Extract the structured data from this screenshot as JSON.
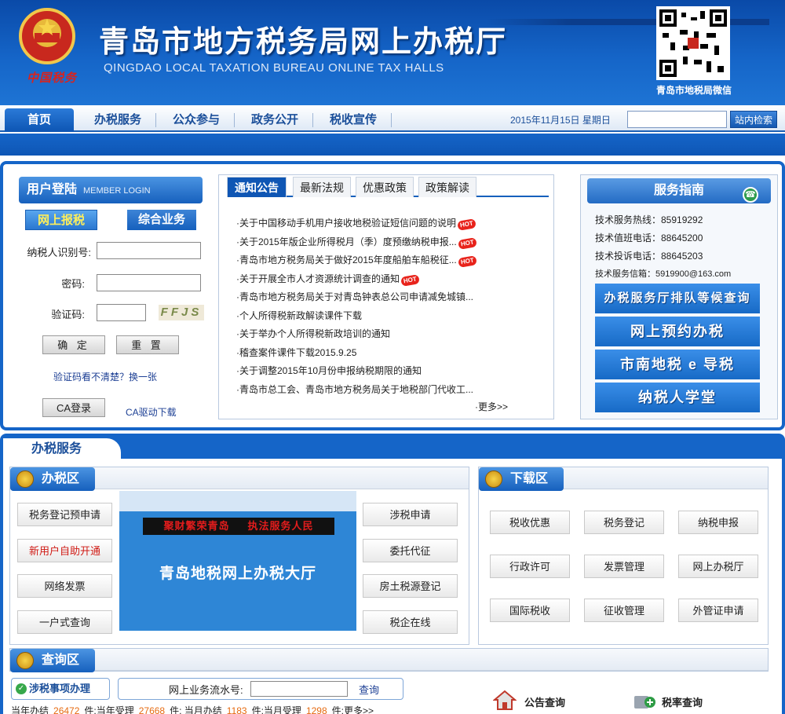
{
  "header": {
    "title_cn": "青岛市地方税务局网上办税厅",
    "title_en": "QINGDAO LOCAL TAXATION BUREAU ONLINE TAX HALLS",
    "china_tax": "中国税务",
    "qr_label": "青岛市地税局微信"
  },
  "nav": {
    "items": [
      "首页",
      "办税服务",
      "公众参与",
      "政务公开",
      "税收宣传"
    ],
    "date": "2015年11月15日  星期日",
    "search_button": "站内检索"
  },
  "login": {
    "title": "用户登陆",
    "subtitle": "MEMBER LOGIN",
    "tab_online": "网上报税",
    "tab_general": "综合业务",
    "taxpayer_label": "纳税人识别号:",
    "password_label": "密码:",
    "captcha_label": "验证码:",
    "captcha_text": "FFJS",
    "confirm": "确 定",
    "reset": "重 置",
    "captcha_refresh": "验证码看不清楚？换一张",
    "ca_login": "CA登录",
    "ca_driver": "CA驱动下载"
  },
  "notice": {
    "tabs": [
      "通知公告",
      "最新法规",
      "优惠政策",
      "政策解读"
    ],
    "items": [
      {
        "text": "·关于中国移动手机用户接收地税验证短信问题的说明",
        "hot": true
      },
      {
        "text": "·关于2015年版企业所得税月（季）度预缴纳税申报...",
        "hot": true
      },
      {
        "text": "·青岛市地方税务局关于做好2015年度船舶车船税征...",
        "hot": true
      },
      {
        "text": "·关于开展全市人才资源统计调查的通知",
        "hot": true
      },
      {
        "text": "·青岛市地方税务局关于对青岛钟表总公司申请减免城镇...",
        "hot": false
      },
      {
        "text": "·个人所得税新政解读课件下载",
        "hot": false
      },
      {
        "text": "·关于举办个人所得税新政培训的通知",
        "hot": false
      },
      {
        "text": "·稽查案件课件下载2015.9.25",
        "hot": false
      },
      {
        "text": "·关于调整2015年10月份申报纳税期限的通知",
        "hot": false
      },
      {
        "text": "·青岛市总工会、青岛市地方税务局关于地税部门代收工...",
        "hot": false
      }
    ],
    "hot_label": "HOT",
    "more": "·更多>>"
  },
  "guide": {
    "title": "服务指南",
    "lines": [
      "技术服务热线：85919292",
      "技术值班电话：88645200",
      "技术投诉电话：88645203",
      "技术服务信箱：5919900@163.com"
    ],
    "banners": [
      "办税服务厅排队等候查询",
      "网上预约办税",
      "市南地税 e 导税",
      "纳税人学堂"
    ]
  },
  "service": {
    "section_title": "办税服务",
    "area_title": "办税区",
    "left_buttons": [
      "税务登记预申请",
      "新用户自助开通",
      "网络发票",
      "一户式查询"
    ],
    "right_buttons": [
      "涉税申请",
      "委托代征",
      "房土税源登记",
      "税企在线"
    ],
    "hall_sign_left": "聚财繁荣青岛",
    "hall_sign_right": "执法服务人民",
    "hall_name": "青岛地税网上办税大厅",
    "download_title": "下载区",
    "download_buttons": [
      "税收优惠",
      "税务登记",
      "纳税申报",
      "行政许可",
      "发票管理",
      "网上办税厅",
      "国际税收",
      "征收管理",
      "外管证申请"
    ],
    "query_title": "查询区",
    "matters_label": "涉税事项办理",
    "flow_label": "网上业务流水号:",
    "query_button": "查询",
    "stats": {
      "year_done_label": "当年办结",
      "year_done": "26472",
      "year_accepted_label": "件;当年受理",
      "year_accepted": "27668",
      "month_done_label": "件; 当月办结",
      "month_done": "1183",
      "month_accepted_label": "件;当月受理",
      "month_accepted": "1298",
      "more": "件;更多>>"
    },
    "notice_query": "公告查询",
    "rate_query": "税率查询"
  },
  "colors": {
    "brand_blue": "#1565c8",
    "hot_red": "#e8231b",
    "stat_orange": "#e66a10"
  }
}
